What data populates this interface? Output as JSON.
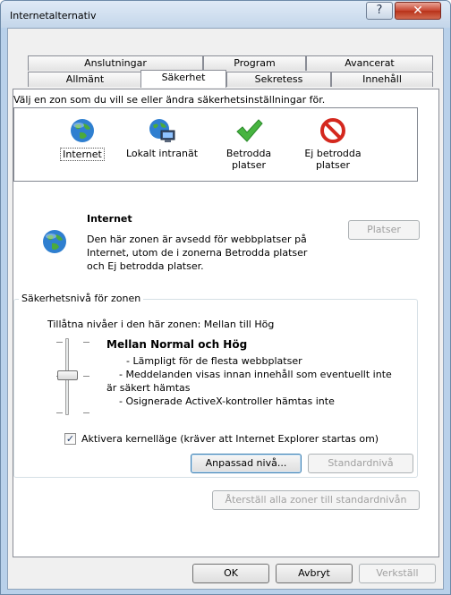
{
  "window": {
    "title": "Internetalternativ",
    "help_glyph": "?",
    "close_glyph": "✕"
  },
  "tabs": {
    "row1": [
      "Anslutningar",
      "Program",
      "Avancerat"
    ],
    "row2": [
      "Allmänt",
      "Säkerhet",
      "Sekretess",
      "Innehåll"
    ],
    "active": "Säkerhet"
  },
  "security": {
    "instruction": "Välj en zon som du vill se eller ändra säkerhetsinställningar för.",
    "zones": [
      {
        "label1": "Internet",
        "label2": "",
        "icon": "globe-icon"
      },
      {
        "label1": "Lokalt intranät",
        "label2": "",
        "icon": "intranet-icon"
      },
      {
        "label1": "Betrodda",
        "label2": "platser",
        "icon": "checkmark-icon"
      },
      {
        "label1": "Ej betrodda",
        "label2": "platser",
        "icon": "restricted-icon"
      }
    ],
    "selected_zone": {
      "title": "Internet",
      "desc1": "Den här zonen är avsedd för webbplatser på",
      "desc2": "Internet, utom de i zonerna Betrodda platser",
      "desc3": "och Ej betrodda platser.",
      "sites_button": "Platser"
    },
    "level_group": {
      "title": "Säkerhetsnivå för zonen",
      "allowed": "Tillåtna nivåer i den här zonen: Mellan till Hög",
      "level_name": "Mellan Normal och Hög",
      "line1": "- Lämpligt för de flesta webbplatser",
      "line2": "- Meddelanden visas innan innehåll som eventuellt inte",
      "line3": "är säkert hämtas",
      "line4": "- Osignerade ActiveX-kontroller hämtas inte",
      "protected_mode_label": "Aktivera kernelläge (kräver att Internet Explorer startas om)",
      "protected_mode_checked": true,
      "custom_level_button": "Anpassad nivå...",
      "default_level_button": "Standardnivå"
    },
    "reset_all_button": "Återställ alla zoner till standardnivån"
  },
  "footer": {
    "ok": "OK",
    "cancel": "Avbryt",
    "apply": "Verkställ"
  },
  "colors": {
    "title_bar": "#c4d6ea",
    "close": "#c7442f",
    "page": "#ffffff",
    "frame": "#f0f0f0"
  }
}
